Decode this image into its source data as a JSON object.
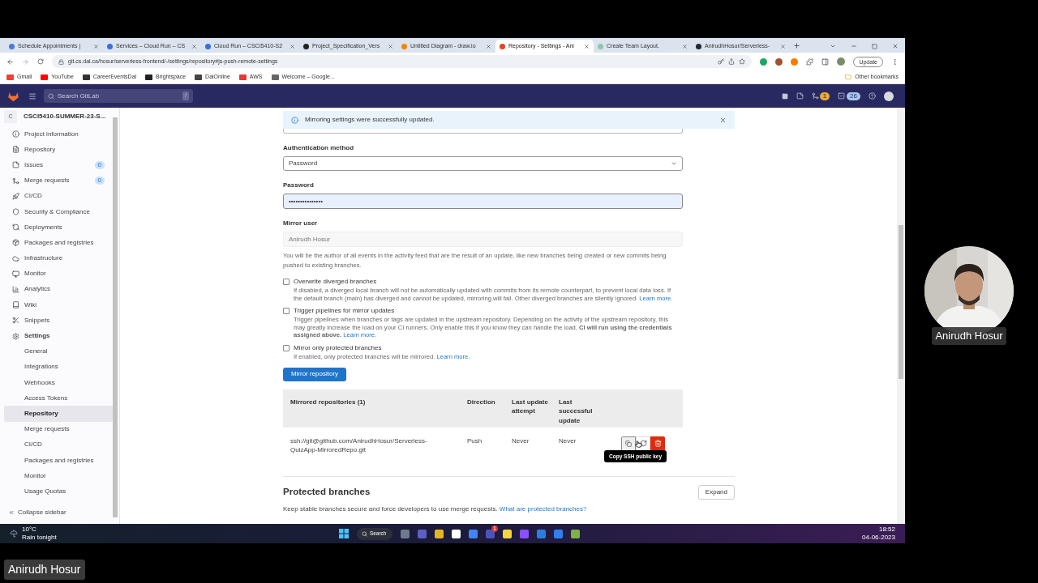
{
  "browser": {
    "tabs": [
      {
        "label": "Schedule Appointments |",
        "selected": false,
        "color": "#4a7bd6"
      },
      {
        "label": "Services – Cloud Run – CS",
        "selected": false,
        "color": "#3b6fd8"
      },
      {
        "label": "Cloud Run – CSCI5410-S2",
        "selected": false,
        "color": "#3b6fd8"
      },
      {
        "label": "Project_Specification_Vers",
        "selected": false,
        "color": "#222222"
      },
      {
        "label": "Untitled Diagram - draw.io",
        "selected": false,
        "color": "#f08705"
      },
      {
        "label": "Repository - Settings - Ani",
        "selected": true,
        "color": "#e24329"
      },
      {
        "label": "Create Team Layout.",
        "selected": false,
        "color": "#8fc9a8"
      },
      {
        "label": "AnirudhHosur/Serverless-",
        "selected": false,
        "color": "#24292f"
      }
    ],
    "url": "git.cs.dal.ca/hosur/serverless-frontend/-/settings/repository#js-push-remote-settings",
    "update_button": "Update",
    "bookmarks": [
      {
        "label": "Gmail",
        "color": "#ea4335"
      },
      {
        "label": "YouTube",
        "color": "#ff0000"
      },
      {
        "label": "CareerEventsDal",
        "color": "#333333"
      },
      {
        "label": "Brightspace",
        "color": "#222222"
      },
      {
        "label": "DalOnline",
        "color": "#444444"
      },
      {
        "label": "AWS",
        "color": "#e53935"
      },
      {
        "label": "Welcome – Google...",
        "color": "#666666"
      }
    ],
    "other_bookmarks": "Other bookmarks"
  },
  "gitlab_header": {
    "search_placeholder": "Search GitLab",
    "search_shortcut": "/",
    "merge_requests_count": "1",
    "todos_count": "26"
  },
  "sidebar": {
    "project_initial": "C",
    "project_name": "CSCI5410-SUMMER-23-S...",
    "items": [
      {
        "label": "Project information",
        "selected": false
      },
      {
        "label": "Repository",
        "selected": false
      },
      {
        "label": "Issues",
        "badge": "0",
        "selected": false
      },
      {
        "label": "Merge requests",
        "badge": "0",
        "selected": false
      },
      {
        "label": "CI/CD",
        "selected": false
      },
      {
        "label": "Security & Compliance",
        "selected": false
      },
      {
        "label": "Deployments",
        "selected": false
      },
      {
        "label": "Packages and registries",
        "selected": false
      },
      {
        "label": "Infrastructure",
        "selected": false
      },
      {
        "label": "Monitor",
        "selected": false
      },
      {
        "label": "Analytics",
        "selected": false
      },
      {
        "label": "Wiki",
        "selected": false
      },
      {
        "label": "Snippets",
        "selected": false
      },
      {
        "label": "Settings",
        "selected": false,
        "children": [
          {
            "label": "General",
            "selected": false
          },
          {
            "label": "Integrations",
            "selected": false
          },
          {
            "label": "Webhooks",
            "selected": false
          },
          {
            "label": "Access Tokens",
            "selected": false
          },
          {
            "label": "Repository",
            "selected": true
          },
          {
            "label": "Merge requests",
            "selected": false
          },
          {
            "label": "CI/CD",
            "selected": false
          },
          {
            "label": "Packages and registries",
            "selected": false
          },
          {
            "label": "Monitor",
            "selected": false
          },
          {
            "label": "Usage Quotas",
            "selected": false
          }
        ]
      }
    ],
    "collapse": "Collapse sidebar"
  },
  "alert": {
    "message": "Mirroring settings were successfully updated."
  },
  "form": {
    "auth_label": "Authentication method",
    "auth_value": "Password",
    "password_label": "Password",
    "password_value": "•••••••••••••••",
    "password_focused": true,
    "user_label": "Mirror user",
    "user_value": "Anirudh Hosur",
    "user_disabled": true,
    "user_help": "You will be the author of all events in the activity feed that are the result of an update, like new branches being created or new commits being pushed to existing branches.",
    "options": [
      {
        "label": "Overwrite diverged branches",
        "checked": false,
        "help": "If disabled, a diverged local branch will not be automatically updated with commits from its remote counterpart, to prevent local data loss. If the default branch (main) has diverged and cannot be updated, mirroring will fail. Other diverged branches are silently ignored.",
        "link": "Learn more."
      },
      {
        "label": "Trigger pipelines for mirror updates",
        "checked": false,
        "help": "Trigger pipelines when branches or tags are updated in the upstream repository. Depending on the activity of the upstream repository, this may greatly increase the load on your CI runners. Only enable this if you know they can handle the load. **CI will run using the credentials assigned above.**",
        "link": "Learn more."
      },
      {
        "label": "Mirror only protected branches",
        "checked": false,
        "help": "If enabled, only protected branches will be mirrored.",
        "link": "Learn more."
      }
    ],
    "submit": "Mirror repository"
  },
  "table": {
    "columns": [
      "Mirrored repositories (1)",
      "Direction",
      "Last update attempt",
      "Last successful update"
    ],
    "rows": [
      {
        "url": "ssh://git@github.com/AnirudhHosur/Serverless-QuizApp-MirroredRepo.git",
        "direction": "Push",
        "last_attempt": "Never",
        "last_success": "Never"
      }
    ],
    "tooltip": "Copy SSH public key"
  },
  "protected_branches": {
    "title": "Protected branches",
    "description": "Keep stable branches secure and force developers to use merge requests.",
    "link": "What are protected branches?",
    "button": "Expand"
  },
  "taskbar": {
    "temperature": "10°C",
    "weather": "Rain tonight",
    "search": "Search",
    "teams_badge": "1",
    "time": "18:52",
    "date": "04-06-2023"
  },
  "webcam": {
    "name": "Anirudh Hosur"
  },
  "participant_label": "Anirudh Hosur"
}
